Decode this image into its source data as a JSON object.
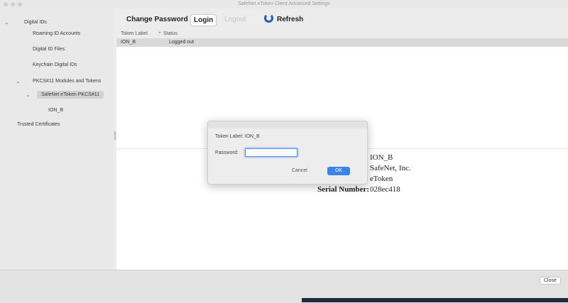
{
  "window": {
    "title": "SafeNet eToken Client Advanced Settings"
  },
  "sidebar": {
    "items": [
      {
        "label": "Digital IDs"
      },
      {
        "label": "Roaming ID Accounts"
      },
      {
        "label": "Digital ID Files"
      },
      {
        "label": "Keychain Digital IDs"
      },
      {
        "label": "PKCS#11 Modules and Tokens"
      },
      {
        "label": "SafeNet eToken PKCS#11"
      },
      {
        "label": "ION_B"
      },
      {
        "label": "Trusted Certificates"
      }
    ]
  },
  "toolbar": {
    "change_password": "Change Password",
    "login": "Login",
    "logout": "Logout",
    "refresh": "Refresh"
  },
  "filter": {
    "token_label": "Token Label",
    "status": "Status"
  },
  "table": {
    "columns": [
      "ION_B",
      "Logged out"
    ]
  },
  "details": {
    "name": "ION_B",
    "manufacturer": "SafeNet, Inc.",
    "model": "eToken",
    "serial_label": "Serial Number:",
    "serial_value": "028ec418"
  },
  "dialog": {
    "token_label": "Token Label: ION_B",
    "password_label": "Password:",
    "password_value": "",
    "cancel": "Cancel",
    "ok": "OK"
  },
  "footer": {
    "close": "Close"
  }
}
